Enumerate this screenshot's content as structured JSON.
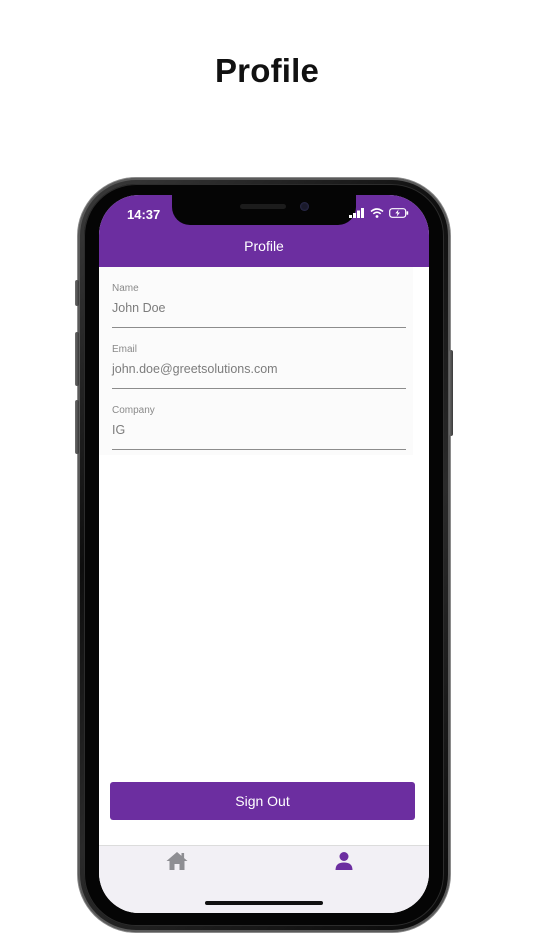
{
  "page": {
    "heading": "Profile"
  },
  "status_bar": {
    "time": "14:37",
    "icons": [
      "signal-icon",
      "wifi-icon",
      "battery-charging-icon"
    ]
  },
  "app": {
    "header_title": "Profile",
    "accent_color": "#6c2ea0"
  },
  "profile_form": {
    "fields": [
      {
        "label": "Name",
        "value": "John Doe"
      },
      {
        "label": "Email",
        "value": "john.doe@greetsolutions.com"
      },
      {
        "label": "Company",
        "value": "IG"
      }
    ]
  },
  "actions": {
    "sign_out_label": "Sign Out"
  },
  "tab_bar": {
    "tabs": [
      {
        "icon": "home-icon",
        "active": false,
        "color": "#8e8e93"
      },
      {
        "icon": "person-icon",
        "active": true,
        "color": "#6c2ea0"
      }
    ]
  }
}
